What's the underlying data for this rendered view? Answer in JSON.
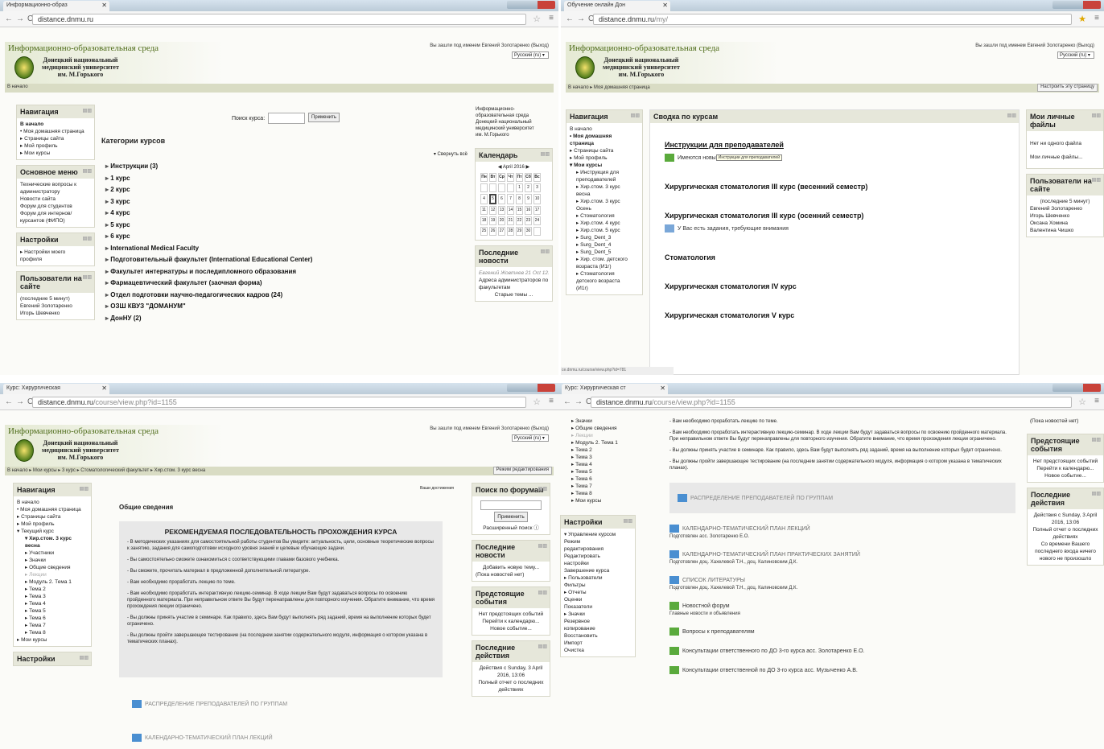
{
  "q1": {
    "tab": "Информационно-образ",
    "url": "distance.dnmu.ru",
    "url_path": "",
    "site_title": "Информационно-образовательная среда",
    "uni": [
      "Донецкий национальный",
      "медицинский университет",
      "им. М.Горького"
    ],
    "login": "Вы зашли под именем Евгений Золотаренко (Выход)",
    "lang": "Русский (ru) ▾",
    "crumb": "В начало",
    "nav": {
      "title": "Навигация",
      "items": [
        "В начало",
        "• Моя домашняя страница",
        "▸ Страницы сайта",
        "▸ Мой профиль",
        "▸ Мои курсы"
      ]
    },
    "menu": {
      "title": "Основное меню",
      "items": [
        "Технические вопросы к",
        "администратору",
        "Новости сайта",
        "Форум для студентов",
        "Форум для интернов/",
        "курсантов (ФИПО)"
      ]
    },
    "settings": {
      "title": "Настройки",
      "items": [
        "▸ Настройки моего",
        "профиля"
      ]
    },
    "users": {
      "title": "Пользователи на сайте",
      "items": [
        "(последние 5 минут)",
        "Евгений Золотаренко",
        "Игорь Шевченко"
      ]
    },
    "search_label": "Поиск курса:",
    "search_btn": "Применить",
    "cats_title": "Категории курсов",
    "collapse": "▾ Свернуть всё",
    "categories": [
      "Инструкции (3)",
      "1 курс",
      "2 курс",
      "3 курс",
      "4 курс",
      "5 курс",
      "6 курс",
      "International Medical Faculty",
      "Подготовительный факультет (International Educational Center)",
      "Факультет интернатуры и последипломного образования",
      "Фармацевтический факультет (заочная форма)",
      "Отдел подготовки научно-педагогических кадров (24)",
      "ОЗШ КВУЗ \"ДОМАНУМ\"",
      "ДонНУ (2)"
    ],
    "about": [
      "Информационно-",
      "образовательная среда",
      "Донецкий национальный",
      "медицинский университет",
      "им. М.Горького"
    ],
    "calendar": {
      "title": "Календарь",
      "month": "April 2016",
      "days": [
        "Пн",
        "Вт",
        "Ср",
        "Чт",
        "Пт",
        "Сб",
        "Вс"
      ],
      "weeks": [
        [
          "",
          "",
          "",
          "",
          "1",
          "2",
          "3"
        ],
        [
          "4",
          "5",
          "6",
          "7",
          "8",
          "9",
          "10"
        ],
        [
          "11",
          "12",
          "13",
          "14",
          "15",
          "16",
          "17"
        ],
        [
          "18",
          "19",
          "20",
          "21",
          "22",
          "23",
          "24"
        ],
        [
          "25",
          "26",
          "27",
          "28",
          "29",
          "30",
          ""
        ]
      ]
    },
    "news": {
      "title": "Последние новости",
      "items": [
        "Евгений Жовтнев 21 Oct 12:01",
        "Адреса администраторов по",
        "факультетам",
        "Старые темы ..."
      ]
    }
  },
  "q2": {
    "tab": "Обучение онлайн Дон",
    "url": "distance.dnmu.ru",
    "url_path": "/my/",
    "crumb": "В начало ▸ Моя домашняя страница",
    "customize": "Настроить эту страницу",
    "login": "Вы зашли под именем Евгений Золотаренко (Выход)",
    "lang": "Русский (ru) ▾",
    "nav": {
      "title": "Навигация",
      "items": [
        "В начало",
        "• Моя домашняя",
        "страница",
        "▸ Страницы сайта",
        "▸ Мой профиль",
        "▾ Мои курсы",
        "▸ Инструкция для",
        "преподавателей",
        "▸ Хир.стом. 3 курс",
        "весна",
        "▸ Хир.стом. 3 курс",
        "Осень",
        "▸ Стоматология",
        "▸ Хир.стом. 4 курс",
        "▸ Хир.стом. 5 курс",
        "▸ Surg_Dent_3",
        "▸ Surg_Dent_4",
        "▸ Surg_Dent_5",
        "▸ Хир. стом. детского",
        "возраста (И1r)",
        "▸ Стоматология",
        "детского возраста",
        "(И1r)"
      ]
    },
    "overview_title": "Сводка по курсам",
    "courses": [
      "Инструкции для преподавателей",
      "Хирургическая стоматология III курс (весенний семестр)",
      "Хирургическая стоматология III курс (осенний семестр)",
      "Стоматология",
      "Хирургическая стоматология IV курс",
      "Хирургическая стоматология V курс"
    ],
    "new_note": "Имеются новы",
    "tooltip": "Инструкции для преподавателей",
    "task_note": "У Вас есть задания, требующие внимания",
    "files": {
      "title": "Мои личные файлы",
      "empty": "Нет ни одного файла",
      "link": "Мои личные файлы..."
    },
    "users": {
      "title": "Пользователи на сайте",
      "items": [
        "(последние 5 минут)",
        "Евгений Золотаренко",
        "Игорь Шевченко",
        "Оксана Хомина",
        "Валентина Чишко"
      ]
    },
    "status": "ce.dnmu.ru/course/view.php?id=781"
  },
  "q3": {
    "tab": "Курс: Хирургическая",
    "url": "distance.dnmu.ru",
    "url_path": "/course/view.php?id=1155",
    "login": "Вы зашли под именем Евгений Золотаренко (Выход)",
    "lang": "Русский (ru) ▾",
    "crumb": "В начало ▸ Мои курсы ▸ 3 курс ▸ Стоматологический факультет ▸ Хир.стом. 3 курс весна",
    "edit": "Режим редактирования",
    "nav": {
      "title": "Навигация",
      "items": [
        "В начало",
        "• Моя домашняя страница",
        "▸ Страницы сайта",
        "▸ Мой профиль",
        "▾ Текущий курс",
        "▾ Хир.стом. 3 курс",
        "весна",
        "▸ Участники",
        "▸ Значки",
        "▸ Общие сведения",
        "▸ Лекции",
        "▸ Модуль 2. Тема 1",
        "▸ Тема 2",
        "▸ Тема 3",
        "▸ Тема 4",
        "▸ Тема 5",
        "▸ Тема 6",
        "▸ Тема 7",
        "▸ Тема 8",
        "▸ Мои курсы"
      ]
    },
    "settings_title": "Настройки",
    "progress": "Ваши достижения",
    "section": "Общие сведения",
    "heading": "РЕКОМЕНДУЕМАЯ ПОСЛЕДОВАТЕЛЬНОСТЬ ПРОХОЖДЕНИЯ КУРСА",
    "paras": [
      "- В методических указаниях для самостоятельной работы студентов Вы увидите: актуальность, цели, основные теоретические вопросы к занятию, задания для самоподготовки исходного уровня знаний и целевые обучающие задачи.",
      "- Вы самостоятельно сможете ознакомиться с соответствующими главами базового учебника.",
      "- Вы сможете, прочитать материал в предложенной дополнительной литературе.",
      "- Вам необходимо проработать лекцию по теме.",
      "- Вам необходимо проработать интерактивную лекцию-семинар. В ходе лекции Вам будут задаваться вопросы по освоению пройденного материала. При неправильном ответе Вы будут перенаправлены для повторного изучения. Обратите внимание, что время прохождения лекции ограничено.",
      "- Вы должны принять участие в семинаре. Как правило, здесь Вам будут выполнять ряд заданий, время на выполнение которых будет ограничено.",
      "- Вы должны пройти завершающее тестирование (на последнем занятии содержательного модуля, информация о котором указана в тематических планах)."
    ],
    "res1": "РАСПРЕДЕЛЕНИЕ ПРЕПОДАВАТЕЛЕЙ ПО ГРУППАМ",
    "res2": "КАЛЕНДАРНО-ТЕМАТИЧЕСКИЙ ПЛАН ЛЕКЦИЙ",
    "forum": {
      "title": "Поиск по форумам",
      "btn": "Применить",
      "adv": "Расширенный поиск ⓘ"
    },
    "news": {
      "title": "Последние новости",
      "items": [
        "Добавить новую тему...",
        "(Пока новостей нет)"
      ]
    },
    "events": {
      "title": "Предстоящие события",
      "items": [
        "Нет предстоящих событий",
        "Перейти к календарю...",
        "Новое событие..."
      ]
    },
    "activity": {
      "title": "Последние действия",
      "items": [
        "Действия с Sunday, 3 April",
        "2016, 13:06",
        "Полный отчет о последних",
        "действиях"
      ]
    }
  },
  "q4": {
    "tab": "Курс: Хирургическая ст",
    "url": "distance.dnmu.ru",
    "url_path": "/course/view.php?id=1155",
    "nav_items": [
      "▸ Значки",
      "▸ Общие сведения",
      "▸ Лекции",
      "▸ Модуль 2. Тема 1",
      "▸ Тема 2",
      "▸ Тема 3",
      "▸ Тема 4",
      "▸ Тема 5",
      "▸ Тема 6",
      "▸ Тема 7",
      "▸ Тема 8",
      "▸ Мои курсы"
    ],
    "settings": {
      "title": "Настройки",
      "items": [
        "▾ Управление курсом",
        "Режим",
        "редактирования",
        "Редактировать",
        "настройки",
        "Завершение курса",
        "▸ Пользователи",
        "Фильтры",
        "▸ Отчеты",
        "Оценки",
        "Показатели",
        "▸ Значки",
        "Резервное",
        "копирование",
        "Восстановить",
        "Импорт",
        "Очистка"
      ]
    },
    "paras": [
      "- Вам необходимо проработать лекцию по теме.",
      "- Вам необходимо проработать интерактивную лекцию-семинар. В ходе лекции Вам будут задаваться вопросы по освоению пройденного материала. При неправильном ответе Вы будут перенаправлены для повторного изучения. Обратите внимание, что время прохождения лекции ограничено.",
      "- Вы должны принять участие в семинаре. Как правило, здесь Вам будут выполнять ряд заданий, время на выполнение которых будет ограничено.",
      "- Вы должны пройти завершающее тестирование (на последнем занятии содержательного модуля, информация о котором указана в тематических планах)."
    ],
    "res": [
      {
        "t": "РАСПРЕДЕЛЕНИЕ ПРЕПОДАВАТЕЛЕЙ ПО ГРУППАМ",
        "s": ""
      },
      {
        "t": "КАЛЕНДАРНО-ТЕМАТИЧЕСКИЙ ПЛАН ЛЕКЦИЙ",
        "s": "Подготовлен асс. Золотаренко Е.О."
      },
      {
        "t": "КАЛЕНДАРНО-ТЕМАТИЧЕСКИЙ ПЛАН ПРАКТИЧЕСКИХ ЗАНЯТИЙ",
        "s": "Подготовлен доц. Хахелевой Т.Н., доц. Калиновским Д.К."
      },
      {
        "t": "СПИСОК ЛИТЕРАТУРЫ",
        "s": "Подготовлен доц. Хахелевой Т.Н., доц. Калиновским Д.К."
      },
      {
        "t": "Новостной форум",
        "s": "Главные новости и объявления"
      },
      {
        "t": "Вопросы к преподавателям",
        "s": ""
      },
      {
        "t": "Консультации ответственного по ДО 3-го курса асс. Золотаренко Е.О.",
        "s": ""
      },
      {
        "t": "Консультации ответственной по ДО 3-го курса асс. Музыченко А.В.",
        "s": ""
      }
    ],
    "news_empty": "(Пока новостей нет)",
    "events": {
      "title": "Предстоящие события",
      "items": [
        "Нет предстоящих событий",
        "Перейти к календарю...",
        "Новое событие..."
      ]
    },
    "activity": {
      "title": "Последние действия",
      "items": [
        "Действия с Sunday, 3 April",
        "2016, 13:06",
        "Полный отчет о последних",
        "действиях",
        "Со времени Вашего",
        "последнего входа ничего",
        "нового не произошло"
      ]
    }
  }
}
